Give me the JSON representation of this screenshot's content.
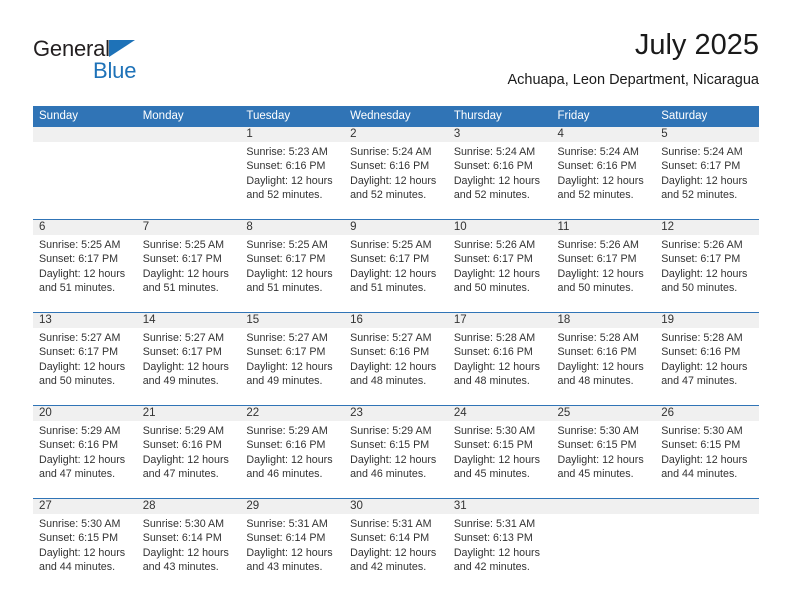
{
  "logo": {
    "word_one": "General",
    "word_two": "Blue",
    "triangle_icon": "triangle-icon",
    "color_dark": "#231f20",
    "color_blue": "#1e72b8"
  },
  "header": {
    "title": "July 2025",
    "location": "Achuapa, Leon Department, Nicaragua"
  },
  "theme": {
    "header_blue": "#3074b6",
    "daynum_band": "#f0f0f0",
    "text": "#333333"
  },
  "weekdays": [
    "Sunday",
    "Monday",
    "Tuesday",
    "Wednesday",
    "Thursday",
    "Friday",
    "Saturday"
  ],
  "weeks": [
    [
      {
        "day": "",
        "sunrise": "",
        "sunset": "",
        "daylight1": "",
        "daylight2": ""
      },
      {
        "day": "",
        "sunrise": "",
        "sunset": "",
        "daylight1": "",
        "daylight2": ""
      },
      {
        "day": "1",
        "sunrise": "Sunrise: 5:23 AM",
        "sunset": "Sunset: 6:16 PM",
        "daylight1": "Daylight: 12 hours",
        "daylight2": "and 52 minutes."
      },
      {
        "day": "2",
        "sunrise": "Sunrise: 5:24 AM",
        "sunset": "Sunset: 6:16 PM",
        "daylight1": "Daylight: 12 hours",
        "daylight2": "and 52 minutes."
      },
      {
        "day": "3",
        "sunrise": "Sunrise: 5:24 AM",
        "sunset": "Sunset: 6:16 PM",
        "daylight1": "Daylight: 12 hours",
        "daylight2": "and 52 minutes."
      },
      {
        "day": "4",
        "sunrise": "Sunrise: 5:24 AM",
        "sunset": "Sunset: 6:16 PM",
        "daylight1": "Daylight: 12 hours",
        "daylight2": "and 52 minutes."
      },
      {
        "day": "5",
        "sunrise": "Sunrise: 5:24 AM",
        "sunset": "Sunset: 6:17 PM",
        "daylight1": "Daylight: 12 hours",
        "daylight2": "and 52 minutes."
      }
    ],
    [
      {
        "day": "6",
        "sunrise": "Sunrise: 5:25 AM",
        "sunset": "Sunset: 6:17 PM",
        "daylight1": "Daylight: 12 hours",
        "daylight2": "and 51 minutes."
      },
      {
        "day": "7",
        "sunrise": "Sunrise: 5:25 AM",
        "sunset": "Sunset: 6:17 PM",
        "daylight1": "Daylight: 12 hours",
        "daylight2": "and 51 minutes."
      },
      {
        "day": "8",
        "sunrise": "Sunrise: 5:25 AM",
        "sunset": "Sunset: 6:17 PM",
        "daylight1": "Daylight: 12 hours",
        "daylight2": "and 51 minutes."
      },
      {
        "day": "9",
        "sunrise": "Sunrise: 5:25 AM",
        "sunset": "Sunset: 6:17 PM",
        "daylight1": "Daylight: 12 hours",
        "daylight2": "and 51 minutes."
      },
      {
        "day": "10",
        "sunrise": "Sunrise: 5:26 AM",
        "sunset": "Sunset: 6:17 PM",
        "daylight1": "Daylight: 12 hours",
        "daylight2": "and 50 minutes."
      },
      {
        "day": "11",
        "sunrise": "Sunrise: 5:26 AM",
        "sunset": "Sunset: 6:17 PM",
        "daylight1": "Daylight: 12 hours",
        "daylight2": "and 50 minutes."
      },
      {
        "day": "12",
        "sunrise": "Sunrise: 5:26 AM",
        "sunset": "Sunset: 6:17 PM",
        "daylight1": "Daylight: 12 hours",
        "daylight2": "and 50 minutes."
      }
    ],
    [
      {
        "day": "13",
        "sunrise": "Sunrise: 5:27 AM",
        "sunset": "Sunset: 6:17 PM",
        "daylight1": "Daylight: 12 hours",
        "daylight2": "and 50 minutes."
      },
      {
        "day": "14",
        "sunrise": "Sunrise: 5:27 AM",
        "sunset": "Sunset: 6:17 PM",
        "daylight1": "Daylight: 12 hours",
        "daylight2": "and 49 minutes."
      },
      {
        "day": "15",
        "sunrise": "Sunrise: 5:27 AM",
        "sunset": "Sunset: 6:17 PM",
        "daylight1": "Daylight: 12 hours",
        "daylight2": "and 49 minutes."
      },
      {
        "day": "16",
        "sunrise": "Sunrise: 5:27 AM",
        "sunset": "Sunset: 6:16 PM",
        "daylight1": "Daylight: 12 hours",
        "daylight2": "and 48 minutes."
      },
      {
        "day": "17",
        "sunrise": "Sunrise: 5:28 AM",
        "sunset": "Sunset: 6:16 PM",
        "daylight1": "Daylight: 12 hours",
        "daylight2": "and 48 minutes."
      },
      {
        "day": "18",
        "sunrise": "Sunrise: 5:28 AM",
        "sunset": "Sunset: 6:16 PM",
        "daylight1": "Daylight: 12 hours",
        "daylight2": "and 48 minutes."
      },
      {
        "day": "19",
        "sunrise": "Sunrise: 5:28 AM",
        "sunset": "Sunset: 6:16 PM",
        "daylight1": "Daylight: 12 hours",
        "daylight2": "and 47 minutes."
      }
    ],
    [
      {
        "day": "20",
        "sunrise": "Sunrise: 5:29 AM",
        "sunset": "Sunset: 6:16 PM",
        "daylight1": "Daylight: 12 hours",
        "daylight2": "and 47 minutes."
      },
      {
        "day": "21",
        "sunrise": "Sunrise: 5:29 AM",
        "sunset": "Sunset: 6:16 PM",
        "daylight1": "Daylight: 12 hours",
        "daylight2": "and 47 minutes."
      },
      {
        "day": "22",
        "sunrise": "Sunrise: 5:29 AM",
        "sunset": "Sunset: 6:16 PM",
        "daylight1": "Daylight: 12 hours",
        "daylight2": "and 46 minutes."
      },
      {
        "day": "23",
        "sunrise": "Sunrise: 5:29 AM",
        "sunset": "Sunset: 6:15 PM",
        "daylight1": "Daylight: 12 hours",
        "daylight2": "and 46 minutes."
      },
      {
        "day": "24",
        "sunrise": "Sunrise: 5:30 AM",
        "sunset": "Sunset: 6:15 PM",
        "daylight1": "Daylight: 12 hours",
        "daylight2": "and 45 minutes."
      },
      {
        "day": "25",
        "sunrise": "Sunrise: 5:30 AM",
        "sunset": "Sunset: 6:15 PM",
        "daylight1": "Daylight: 12 hours",
        "daylight2": "and 45 minutes."
      },
      {
        "day": "26",
        "sunrise": "Sunrise: 5:30 AM",
        "sunset": "Sunset: 6:15 PM",
        "daylight1": "Daylight: 12 hours",
        "daylight2": "and 44 minutes."
      }
    ],
    [
      {
        "day": "27",
        "sunrise": "Sunrise: 5:30 AM",
        "sunset": "Sunset: 6:15 PM",
        "daylight1": "Daylight: 12 hours",
        "daylight2": "and 44 minutes."
      },
      {
        "day": "28",
        "sunrise": "Sunrise: 5:30 AM",
        "sunset": "Sunset: 6:14 PM",
        "daylight1": "Daylight: 12 hours",
        "daylight2": "and 43 minutes."
      },
      {
        "day": "29",
        "sunrise": "Sunrise: 5:31 AM",
        "sunset": "Sunset: 6:14 PM",
        "daylight1": "Daylight: 12 hours",
        "daylight2": "and 43 minutes."
      },
      {
        "day": "30",
        "sunrise": "Sunrise: 5:31 AM",
        "sunset": "Sunset: 6:14 PM",
        "daylight1": "Daylight: 12 hours",
        "daylight2": "and 42 minutes."
      },
      {
        "day": "31",
        "sunrise": "Sunrise: 5:31 AM",
        "sunset": "Sunset: 6:13 PM",
        "daylight1": "Daylight: 12 hours",
        "daylight2": "and 42 minutes."
      },
      {
        "day": "",
        "sunrise": "",
        "sunset": "",
        "daylight1": "",
        "daylight2": ""
      },
      {
        "day": "",
        "sunrise": "",
        "sunset": "",
        "daylight1": "",
        "daylight2": ""
      }
    ]
  ]
}
